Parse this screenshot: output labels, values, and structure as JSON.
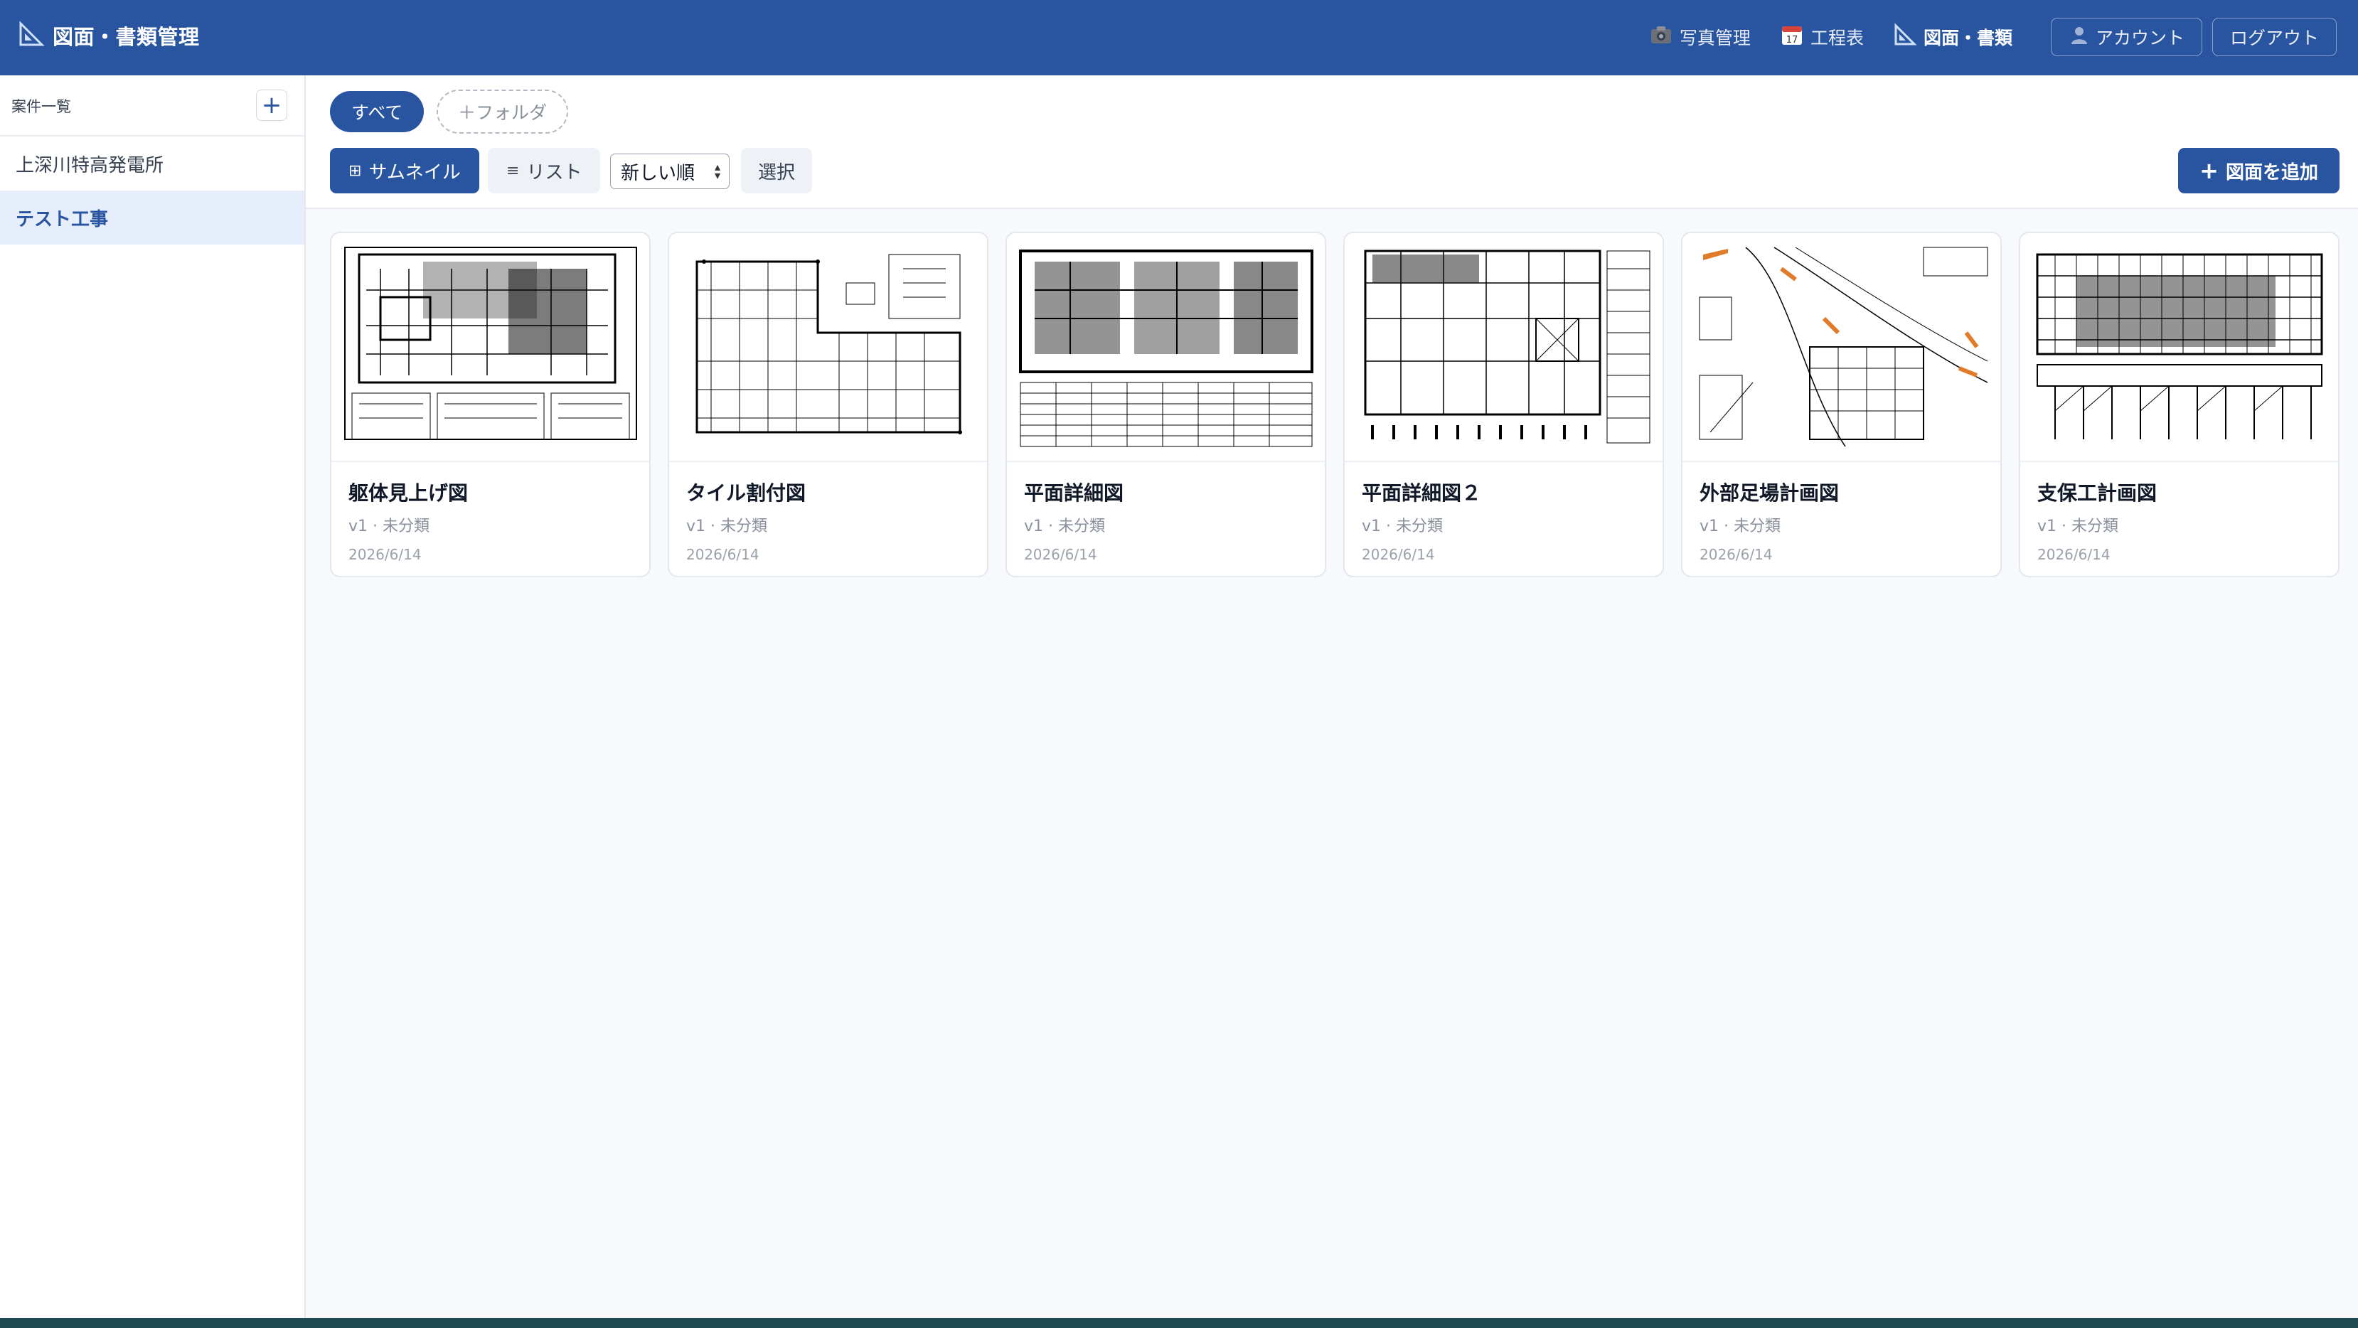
{
  "header": {
    "title": "図面・書類管理",
    "nav": [
      {
        "label": "写真管理",
        "icon": "camera-icon"
      },
      {
        "label": "工程表",
        "icon": "calendar-icon"
      },
      {
        "label": "図面・書類",
        "icon": "ruler-triangle-icon"
      }
    ],
    "account_label": "アカウント",
    "logout_label": "ログアウト"
  },
  "sidebar": {
    "title": "案件一覧",
    "add_label": "+",
    "projects": [
      {
        "label": "上深川特高発電所"
      },
      {
        "label": "テスト工事"
      }
    ]
  },
  "toolbar": {
    "folders": {
      "all": "すべて",
      "add_folder": "＋フォルダ"
    },
    "view_thumbnail": "サムネイル",
    "view_list": "リスト",
    "sort_selected": "新しい順",
    "select_label": "選択",
    "add_drawing": "図面を追加"
  },
  "drawings": [
    {
      "title": "躯体見上げ図",
      "meta": "v1 · 未分類",
      "date": "2026/6/14"
    },
    {
      "title": "タイル割付図",
      "meta": "v1 · 未分類",
      "date": "2026/6/14"
    },
    {
      "title": "平面詳細図",
      "meta": "v1 · 未分類",
      "date": "2026/6/14"
    },
    {
      "title": "平面詳細図２",
      "meta": "v1 · 未分類",
      "date": "2026/6/14"
    },
    {
      "title": "外部足場計画図",
      "meta": "v1 · 未分類",
      "date": "2026/6/14"
    },
    {
      "title": "支保工計画図",
      "meta": "v1 · 未分類",
      "date": "2026/6/14"
    }
  ],
  "colors": {
    "primary": "#2955a0",
    "active_bg": "#e5eefa",
    "accent_orange": "#e07b2a"
  }
}
